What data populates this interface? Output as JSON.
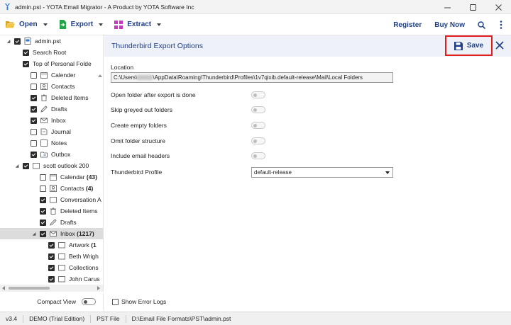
{
  "window": {
    "title": "admin.pst - YOTA Email Migrator - A Product by YOTA Software Inc"
  },
  "toolbar": {
    "open": "Open",
    "export": "Export",
    "extract": "Extract",
    "register": "Register",
    "buy": "Buy Now"
  },
  "tree": {
    "root": "admin.pst",
    "search_root": "Search Root",
    "top_folder": "Top of Personal Folde",
    "calendar": "Calender",
    "contacts": "Contacts",
    "deleted": "Deleted Items",
    "drafts": "Drafts",
    "inbox": "Inbox",
    "journal": "Journal",
    "notes": "Notes",
    "outbox": "Outbox",
    "scott": "scott outlook 200",
    "calendar2": "Calendar",
    "calendar2_count": "(43)",
    "contacts2": "Contacts",
    "contacts2_count": "(4)",
    "conversation": "Conversation A",
    "deleted2": "Deleted Items",
    "drafts2": "Drafts",
    "inbox2": "Inbox",
    "inbox2_count": "(1217)",
    "artwork": "Artwork",
    "artwork_count": "(1",
    "beth": "Beth Wrigh",
    "collections": "Collections",
    "john": "John Carus"
  },
  "compact": {
    "label": "Compact View"
  },
  "panel": {
    "title": "Thunderbird Export Options",
    "save": "Save",
    "location_label": "Location",
    "location_prefix": "C:\\Users\\",
    "location_suffix": "\\AppData\\Roaming\\Thunderbird\\Profiles\\1v7qixib.default-release\\Mail\\Local Folders",
    "options": {
      "open_folder": "Open folder after export is done",
      "skip_greyed": "Skip greyed out folders",
      "create_empty": "Create empty folders",
      "omit_structure": "Omit folder structure",
      "include_headers": "Include email headers"
    },
    "profile_label": "Thunderbird Profile",
    "profile_value": "default-release",
    "error_logs": "Show Error Logs"
  },
  "status": {
    "version": "v3.4",
    "edition": "DEMO (Trial Edition)",
    "file_type": "PST File",
    "path": "D:\\Email File Formats\\PST\\admin.pst"
  },
  "colors": {
    "accent": "#1f3f8a",
    "highlight": "#e01e1e",
    "panel_header": "#eef2f8"
  },
  "icons": [
    "app-icon",
    "minimize-icon",
    "maximize-icon",
    "close-icon",
    "open-folder-icon",
    "export-icon",
    "extract-icon",
    "search-icon",
    "more-icon",
    "save-icon",
    "panel-close-icon",
    "folder-icon",
    "calendar-icon",
    "contacts-icon",
    "trash-icon",
    "drafts-icon",
    "mail-icon",
    "journal-icon",
    "notes-icon",
    "outbox-icon"
  ]
}
